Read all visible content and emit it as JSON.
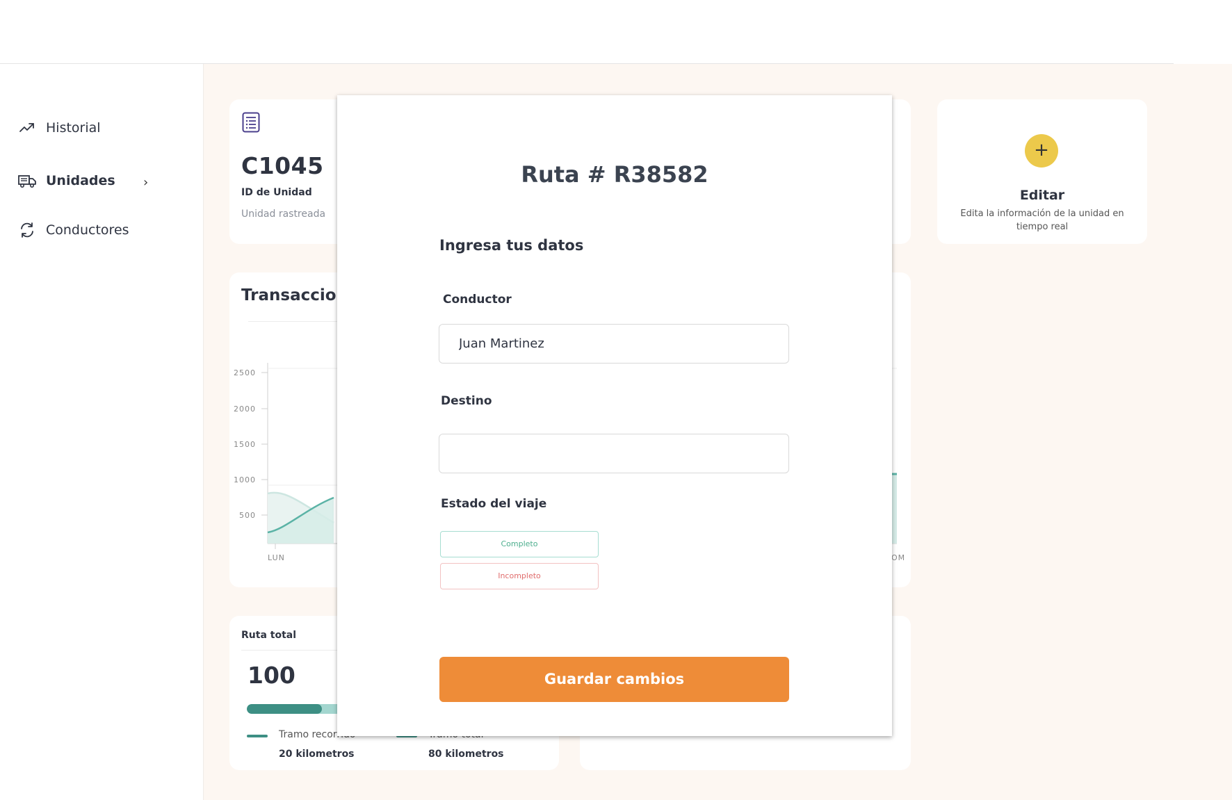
{
  "sidebar": {
    "items": [
      {
        "label": "Historial",
        "icon": "trending-up-icon"
      },
      {
        "label": "Unidades",
        "icon": "truck-icon",
        "active": true
      },
      {
        "label": "Conductores",
        "icon": "refresh-icon"
      }
    ]
  },
  "unit_card": {
    "id": "C1045",
    "id_label": "ID de Unidad",
    "status": "Unidad rastreada"
  },
  "edit_card": {
    "plus": "+",
    "title": "Editar",
    "description": "Edita la información de la unidad en tiempo real"
  },
  "chart_data": {
    "type": "area",
    "title": "Transaccion",
    "y_ticks": [
      "2500",
      "2000",
      "1500",
      "1000",
      "500"
    ],
    "x_ticks_visible": [
      "LUN",
      "OM"
    ],
    "series": [
      {
        "color": "#5bb3a6",
        "visible_start_value": 500
      },
      {
        "color": "#cde6e1",
        "visible_start_value": 1000
      }
    ]
  },
  "route_card": {
    "label": "Ruta total",
    "value": "100",
    "progress_fraction": 0.25,
    "legend": [
      {
        "label": "Tramo recorrido",
        "value": "20 kilometros"
      },
      {
        "label": "Tramo total",
        "value": "80 kilometros"
      }
    ]
  },
  "modal": {
    "title": "Ruta # R38582",
    "heading": "Ingresa tus datos",
    "conductor_label": "Conductor",
    "conductor_value": "Juan Martinez",
    "destino_label": "Destino",
    "destino_value": "",
    "estado_label": "Estado del viaje",
    "status_options": [
      "Completo",
      "Incompleto"
    ],
    "save_label": "Guardar cambios"
  },
  "colors": {
    "accent_orange": "#ee8c38",
    "accent_yellow": "#ecc94b",
    "teal": "#3d8f84",
    "background": "#fdf7f2"
  }
}
